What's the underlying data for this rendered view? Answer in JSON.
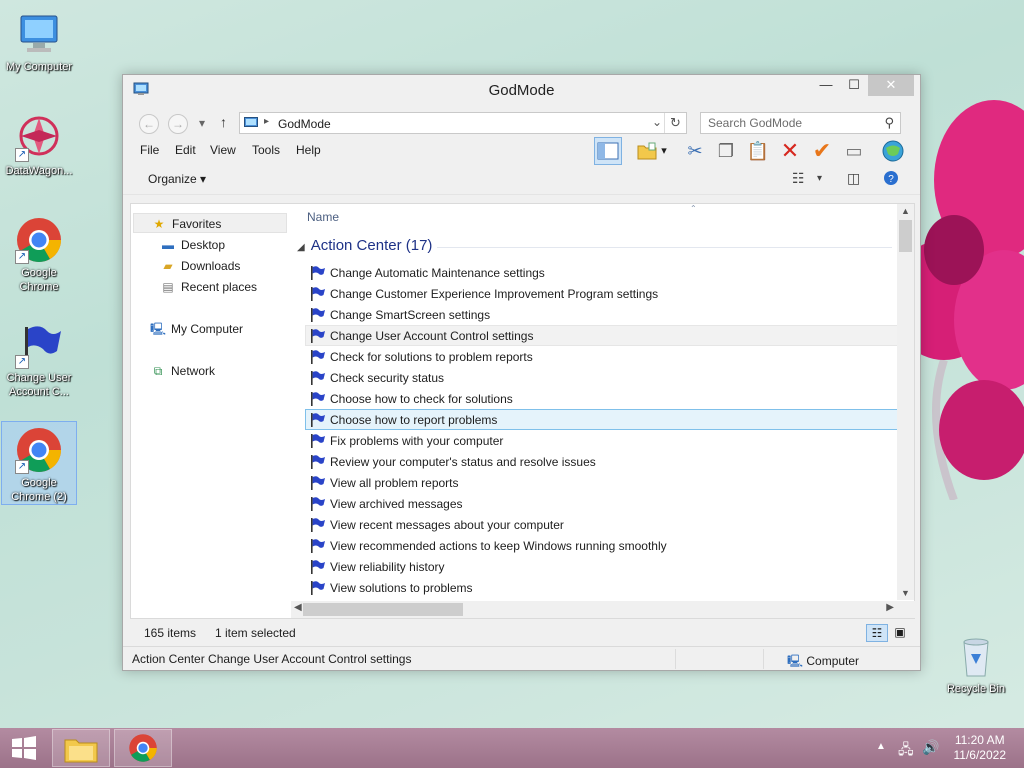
{
  "desktop": {
    "icons": [
      {
        "label": "My Computer"
      },
      {
        "label": "DataWagon..."
      },
      {
        "label": "Google Chrome"
      },
      {
        "label": "Change User Account C..."
      },
      {
        "label": "Google Chrome (2)"
      },
      {
        "label": "Recycle Bin"
      }
    ]
  },
  "window": {
    "title": "GodMode",
    "controls": {
      "minimize": "—",
      "maximize": "☐",
      "close": "✕"
    }
  },
  "navbar": {
    "address": "GodMode",
    "search_placeholder": "Search GodMode"
  },
  "menu": [
    "File",
    "Edit",
    "View",
    "Tools",
    "Help"
  ],
  "command_bar": {
    "organize": "Organize"
  },
  "nav_pane": {
    "favorites": "Favorites",
    "desktop": "Desktop",
    "downloads": "Downloads",
    "recent_places": "Recent places",
    "my_computer": "My Computer",
    "network": "Network"
  },
  "file_pane": {
    "column_name": "Name",
    "group_title": "Action Center (17)",
    "items": [
      "Change Automatic Maintenance settings",
      "Change Customer Experience Improvement Program settings",
      "Change SmartScreen settings",
      "Change User Account Control settings",
      "Check for solutions to problem reports",
      "Check security status",
      "Choose how to check for solutions",
      "Choose how to report problems",
      "Fix problems with your computer",
      "Review your computer's status and resolve issues",
      "View all problem reports",
      "View archived messages",
      "View recent messages about your computer",
      "View recommended actions to keep Windows running smoothly",
      "View reliability history",
      "View solutions to problems"
    ],
    "hover_index": 3,
    "selected_index": 7
  },
  "status": {
    "item_count": "165 items",
    "selection": "1 item selected"
  },
  "details": {
    "text": "Action Center Change User Account Control settings",
    "location": "Computer"
  },
  "clock": {
    "time": "11:20 AM",
    "date": "11/6/2022"
  },
  "colors": {
    "accent_selection": "#e5f3fb",
    "selection_border": "#7fc0ea",
    "group_header": "#1e3287",
    "taskbar": "#a07c91"
  }
}
